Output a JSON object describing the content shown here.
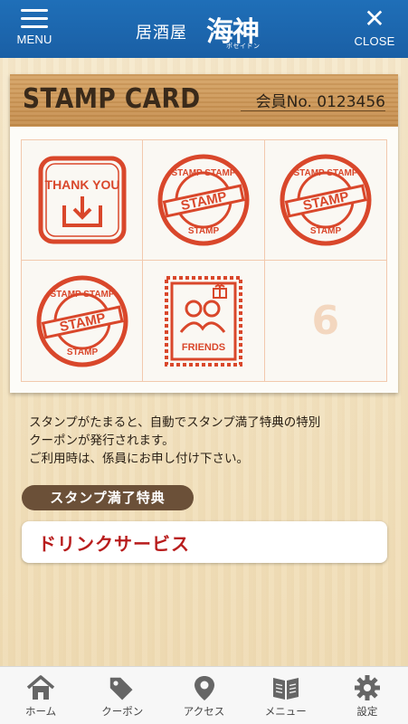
{
  "header": {
    "menu_label": "MENU",
    "close_label": "CLOSE",
    "brand_prefix": "居酒屋",
    "brand_name": "海神",
    "brand_kana": "ポセイドン"
  },
  "card": {
    "title": "STAMP CARD",
    "member_label": "会員No.",
    "member_number": "0123456",
    "slots": [
      {
        "type": "thank-you",
        "text": "THANK YOU"
      },
      {
        "type": "stamp",
        "text": "STAMP"
      },
      {
        "type": "stamp",
        "text": "STAMP"
      },
      {
        "type": "stamp",
        "text": "STAMP"
      },
      {
        "type": "friends",
        "text": "FRIENDS"
      },
      {
        "type": "empty",
        "number": "6"
      }
    ]
  },
  "description": {
    "line1": "スタンプがたまると、自動でスタンプ満了特典の特別",
    "line2": "クーポンが発行されます。",
    "line3": "ご利用時は、係員にお申し付け下さい。"
  },
  "reward": {
    "label": "スタンプ満了特典",
    "value": "ドリンクサービス"
  },
  "tabs": [
    {
      "label": "ホーム",
      "icon": "home-icon"
    },
    {
      "label": "クーポン",
      "icon": "tag-icon"
    },
    {
      "label": "アクセス",
      "icon": "map-pin-icon"
    },
    {
      "label": "メニュー",
      "icon": "book-icon"
    },
    {
      "label": "設定",
      "icon": "gear-icon"
    }
  ],
  "colors": {
    "header_blue": "#1f6fb8",
    "stamp_red": "#d9472b",
    "reward_red": "#b81c1c",
    "label_brown": "#6b5038"
  }
}
